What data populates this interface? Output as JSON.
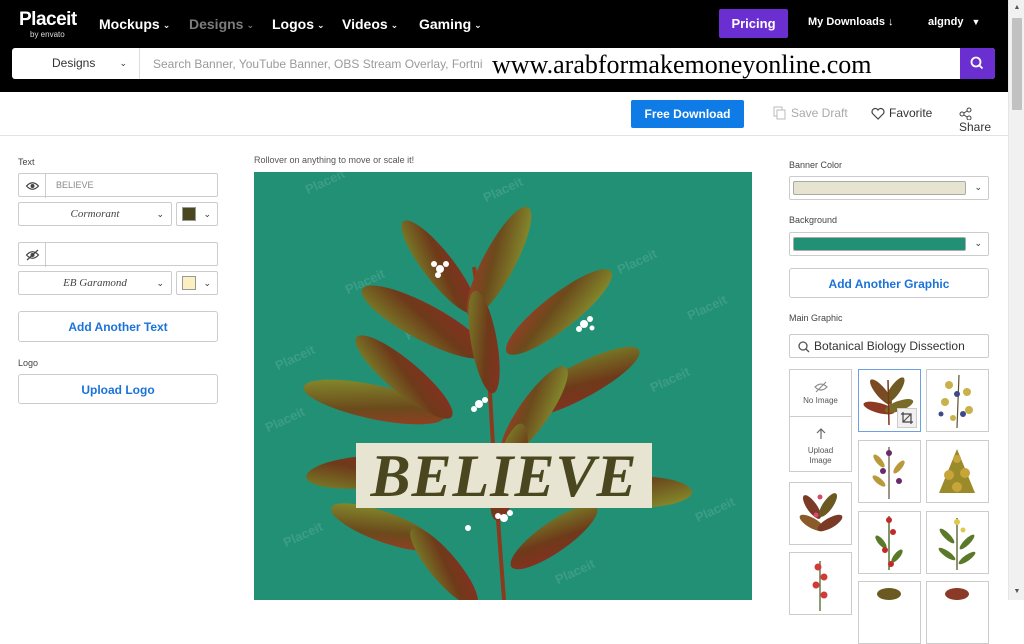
{
  "brand": {
    "name": "Placeit",
    "sub": "by envato"
  },
  "nav": {
    "items": [
      {
        "label": "Mockups",
        "dim": false
      },
      {
        "label": "Designs",
        "dim": true
      },
      {
        "label": "Logos",
        "dim": false
      },
      {
        "label": "Videos",
        "dim": false
      },
      {
        "label": "Gaming",
        "dim": false
      }
    ],
    "pricing": "Pricing",
    "my_downloads": "My Downloads ↓",
    "user": "algndy"
  },
  "search": {
    "category": "Designs",
    "placeholder": "Search Banner, YouTube Banner, OBS Stream Overlay, Fortnite...",
    "overlay_url": "www.arabformakemoneyonline.com"
  },
  "actions": {
    "free_download": "Free Download",
    "save_draft": "Save Draft",
    "favorite": "Favorite",
    "share": "Share"
  },
  "left": {
    "text_label": "Text",
    "text1_value": "BELIEVE",
    "font1": "Cormorant",
    "font1_color": "#4a4720",
    "text2_value": "",
    "font2": "EB Garamond",
    "font2_color": "#fdf0c0",
    "add_text": "Add Another Text",
    "logo_label": "Logo",
    "upload_logo": "Upload Logo"
  },
  "canvas": {
    "hint": "Rollover on anything to move or scale it!",
    "headline": "BELIEVE",
    "watermark": "Placeit",
    "background_color": "#229075",
    "band_color": "#e7e4d2"
  },
  "right": {
    "banner_color_label": "Banner Color",
    "banner_color": "#e6e3d1",
    "background_label": "Background",
    "background_color": "#229075",
    "add_graphic": "Add Another Graphic",
    "main_graphic_label": "Main Graphic",
    "graphic_search_value": "Botanical  Biology Dissection",
    "no_image": "No Image",
    "upload_image": "Upload Image"
  },
  "colors": {
    "accent": "#6b2fd1",
    "primary_blue": "#0e7be6",
    "link_blue": "#1a73d9"
  }
}
